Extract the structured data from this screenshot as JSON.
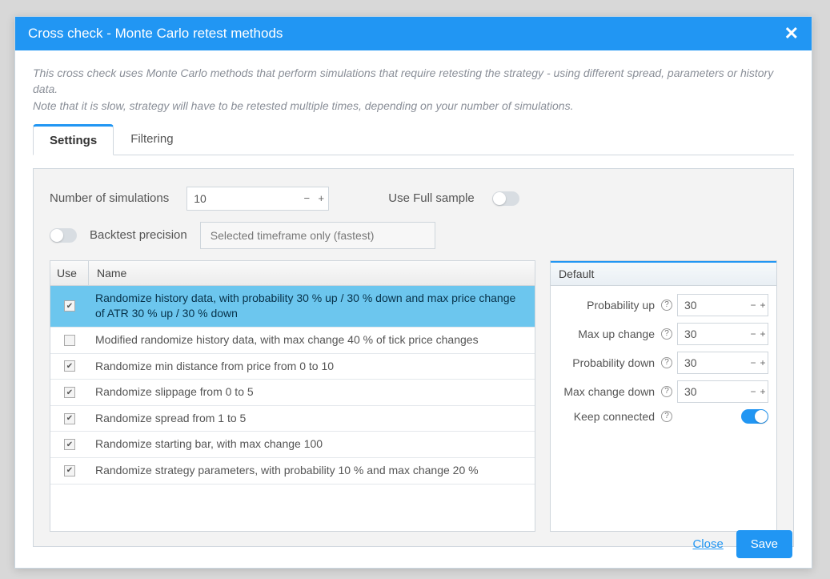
{
  "header": {
    "title": "Cross check - Monte Carlo retest methods"
  },
  "description": {
    "line1": "This cross check uses Monte Carlo methods that perform simulations that require retesting the strategy - using different spread, parameters or history data.",
    "line2": "Note that it is slow, strategy will have to be retested multiple times, depending on your number of simulations."
  },
  "tabs": {
    "settings": "Settings",
    "filtering": "Filtering"
  },
  "settings": {
    "num_simulations_label": "Number of simulations",
    "num_simulations_value": "10",
    "use_full_sample_label": "Use Full sample",
    "backtest_precision_label": "Backtest precision",
    "backtest_precision_value": "Selected timeframe only (fastest)"
  },
  "table": {
    "header_use": "Use",
    "header_name": "Name",
    "rows": [
      {
        "checked": true,
        "name": "Randomize history data, with probability 30 % up / 30 % down and max price change of ATR 30 % up / 30 % down",
        "selected": true
      },
      {
        "checked": false,
        "name": "Modified randomize history data, with max change 40 % of tick price changes",
        "selected": false
      },
      {
        "checked": true,
        "name": "Randomize min distance from price from 0 to 10",
        "selected": false
      },
      {
        "checked": true,
        "name": "Randomize slippage from 0 to 5",
        "selected": false
      },
      {
        "checked": true,
        "name": "Randomize spread from 1 to 5",
        "selected": false
      },
      {
        "checked": true,
        "name": "Randomize starting bar, with max change 100",
        "selected": false
      },
      {
        "checked": true,
        "name": "Randomize strategy parameters, with probability 10 % and max change 20 %",
        "selected": false
      }
    ]
  },
  "side": {
    "header": "Default",
    "prob_up_label": "Probability up",
    "prob_up_value": "30",
    "max_up_label": "Max up change",
    "max_up_value": "30",
    "prob_down_label": "Probability down",
    "prob_down_value": "30",
    "max_down_label": "Max change down",
    "max_down_value": "30",
    "keep_connected_label": "Keep connected"
  },
  "footer": {
    "close": "Close",
    "save": "Save"
  }
}
